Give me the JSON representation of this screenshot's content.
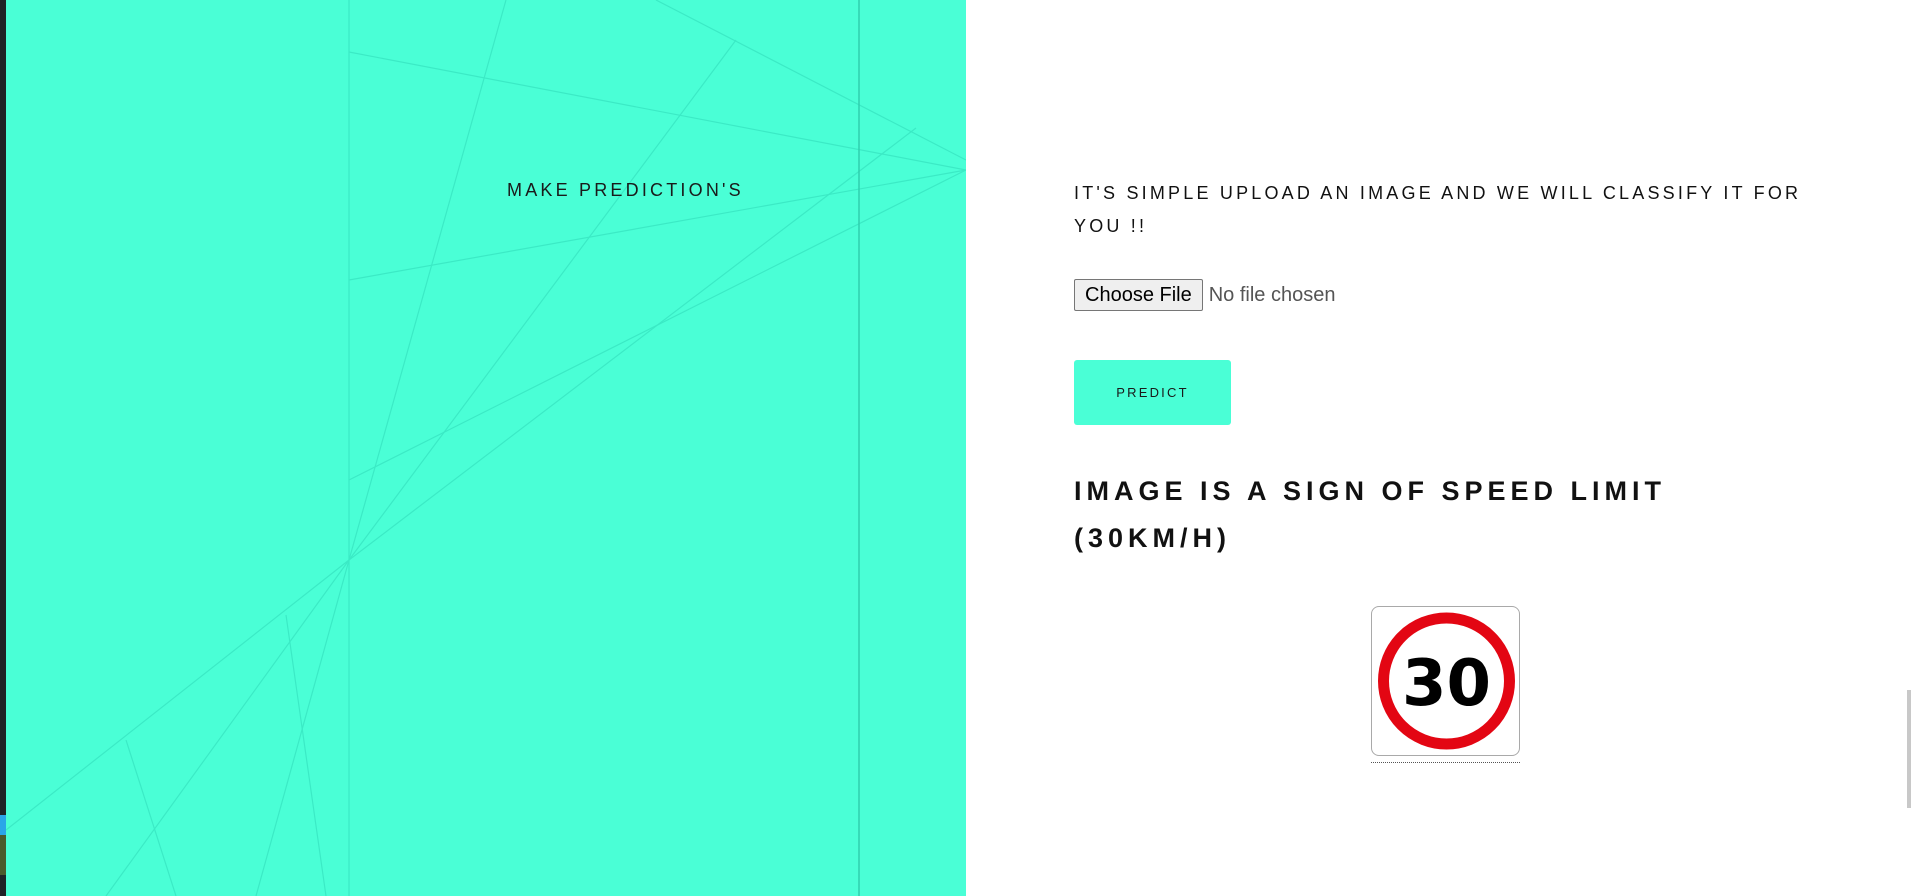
{
  "left_panel": {
    "title": "MAKE PREDICTION'S",
    "background_color": "#4affd6"
  },
  "right_panel": {
    "intro": "IT'S SIMPLE UPLOAD AN IMAGE AND WE WILL CLASSIFY IT FOR YOU !!",
    "file_input": {
      "button_label": "Choose File",
      "status": "No file chosen"
    },
    "predict_button": {
      "label": "PREDICT",
      "color": "#4affd6"
    },
    "result": "IMAGE IS A SIGN OF SPEED LIMIT (30KM/H)",
    "sign_image": {
      "value": "30",
      "ring_color": "#e30613"
    }
  }
}
